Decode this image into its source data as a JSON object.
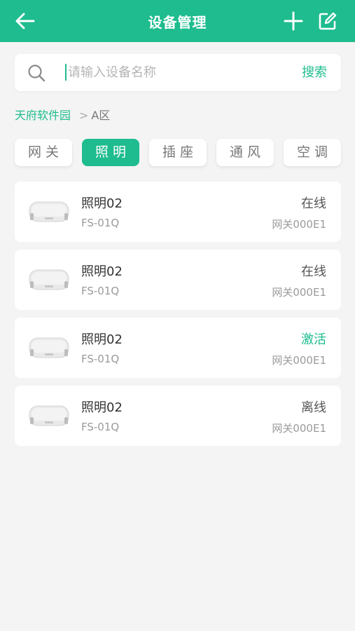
{
  "header": {
    "title": "设备管理",
    "back_icon": "arrow-left-icon",
    "add_icon": "plus-icon",
    "edit_icon": "edit-icon"
  },
  "search": {
    "placeholder": "请输入设备名称",
    "value": "",
    "button_label": "搜索",
    "icon": "search-icon"
  },
  "breadcrumb": {
    "root": "天府软件园",
    "separator": ">",
    "current": "A区"
  },
  "tabs": [
    {
      "label": "网关",
      "active": false
    },
    {
      "label": "照明",
      "active": true
    },
    {
      "label": "插座",
      "active": false
    },
    {
      "label": "通风",
      "active": false
    },
    {
      "label": "空调",
      "active": false
    }
  ],
  "devices": [
    {
      "name": "照明02",
      "model": "FS-01Q",
      "status": "在线",
      "gateway": "网关000E1"
    },
    {
      "name": "照明02",
      "model": "FS-01Q",
      "status": "在线",
      "gateway": "网关000E1"
    },
    {
      "name": "照明02",
      "model": "FS-01Q",
      "status": "激活",
      "gateway": "网关000E1"
    },
    {
      "name": "照明02",
      "model": "FS-01Q",
      "status": "离线",
      "gateway": "网关000E1"
    }
  ],
  "colors": {
    "accent": "#1ebc8e",
    "background": "#f4f4f4",
    "card": "#ffffff"
  }
}
